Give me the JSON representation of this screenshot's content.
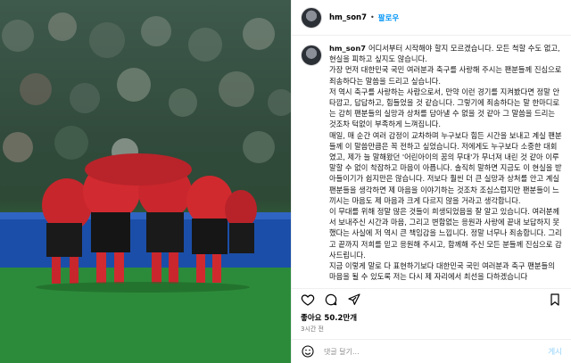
{
  "post": {
    "username": "hm_son7",
    "dot": "•",
    "follow_label": "팔로우",
    "caption_lines": [
      "어디서부터 시작해야 할지 모르겠습니다. 모든 척할 수도 없고, 현실을 피하고 싶지도 않습니다.",
      "가장 먼저 대한민국 국민 여러분과 축구를 사랑해 주시는 팬분들께 진심으로 죄송하다는 말씀을 드리고 싶습니다.",
      "저 역시 축구를 사랑하는 사람으로서, 만약 이런 경기를 지켜봤다면 정말 안타깝고, 답답하고, 힘들었을 것 같습니다. 그렇기에 죄송하다는 말 한마디로는 감히 팬분들의 실망과 상처를 담아낼 수 없을 것 같아 그 말씀을 드리는 것조차 턱없이 부족하게 느껴집니다.",
      "매일, 매 순간 여러 감정이 교차하며 누구보다 힘든 시간을 보내고 계실 팬분들께 이 말씀만큼은 꼭 전하고 싶었습니다. 저에게도 누구보다 소중한 대회였고, 제가 늘 말해왔던 '어린아이의 꿈의 무대'가 무너져 내린 것 같아 이루 말할 수 없이 착잡하고 마음이 아픕니다. 솔직히 말하면 지금도 이 현실을 받아들이기가 쉽지만은 않습니다. 저보다 훨씬 더 큰 실망과 상처를 안고 계실 팬분들을 생각하면 제 마음을 이야기하는 것조차 조심스럽지만 팬분들이 느끼시는 마음도 제 마음과 크게 다르지 않을 거라고 생각합니다.",
      "이 무대를 위해 정말 많은 것들이 희생되었음을 잘 알고 있습니다. 여러분께서 보내주신 시간과 마음, 그리고 변함없는 응원과 사랑에 끝내 보답하지 못했다는 사실에 저 역시 큰 책임감을 느낍니다. 정말 너무나 죄송합니다. 그리고 끝까지 저희를 믿고 응원해 주시고, 함께해 주신 모든 분들께 진심으로 감사드립니다.",
      "지금 이렇게 말로 다 표현하기보다 대한민국 국민 여러분과 축구 팬분들의 마음을 될 수 있도록 저는 다시 제 자리에서 최선을 다하겠습니다"
    ],
    "likes_text": "좋아요 50.2만개",
    "time_text": "3시간 전",
    "comment_placeholder": "댓글 달기...",
    "post_label": "게시"
  }
}
